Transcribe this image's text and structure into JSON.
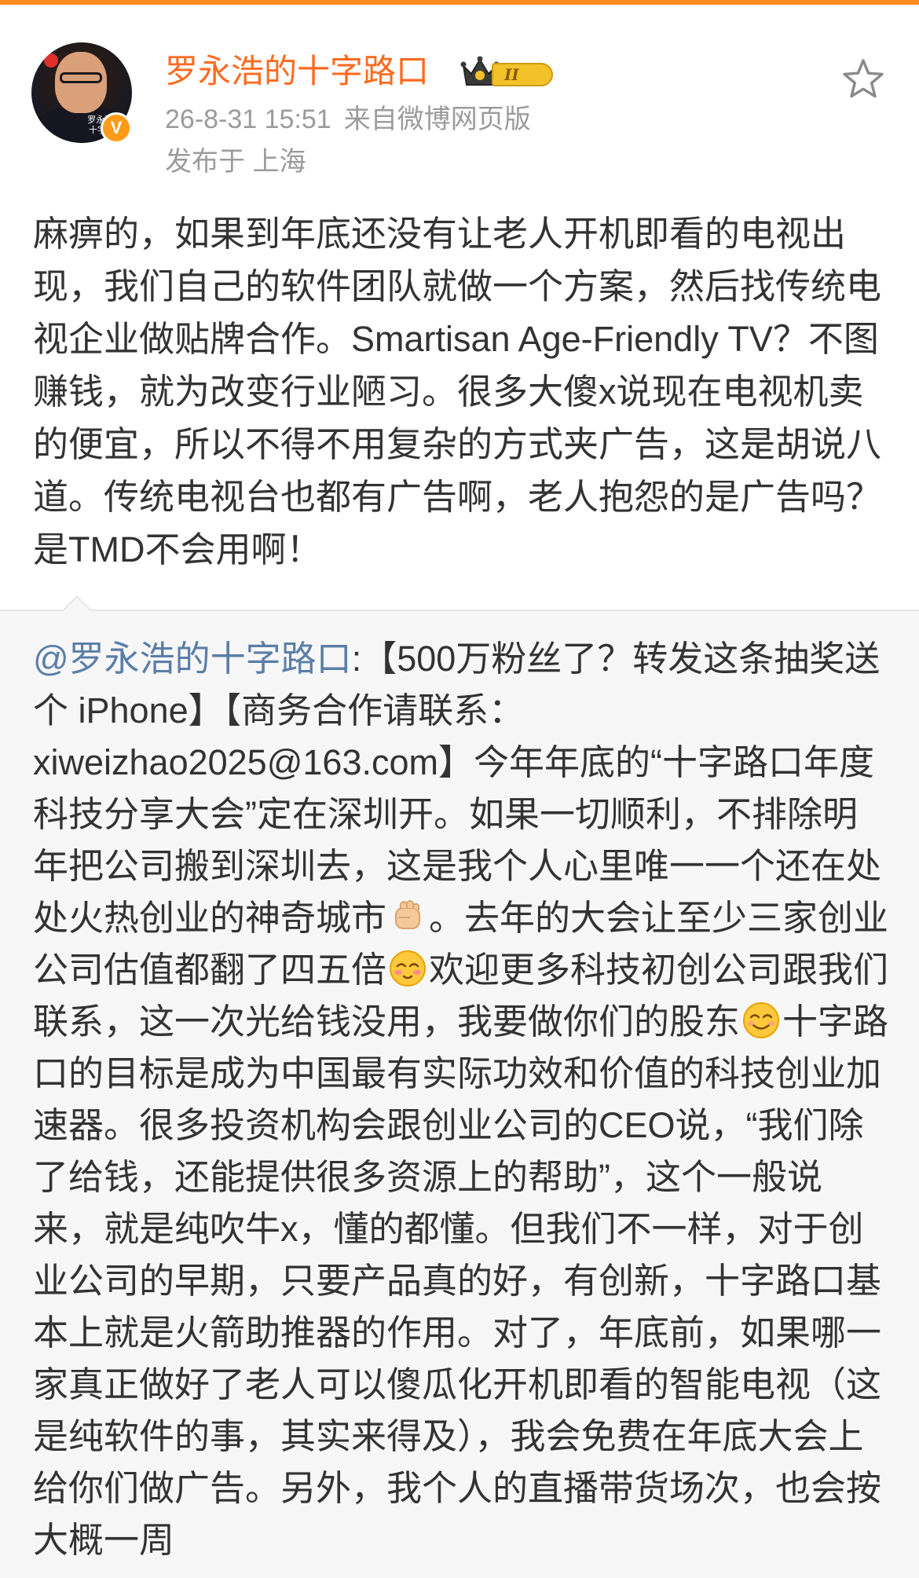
{
  "post": {
    "author": {
      "name": "罗永浩的十字路口",
      "avatar_caption": "罗永浩 的十字路口",
      "verified_mark": "V",
      "vip_level": "II"
    },
    "meta": {
      "time": "26-8-31 15:51",
      "source": "来自微博网页版",
      "location": "发布于 上海"
    },
    "text": "麻痹的，如果到年底还没有让老人开机即看的电视出现，我们自己的软件团队就做一个方案，然后找传统电视企业做贴牌合作。Smartisan Age-Friendly TV？不图赚钱，就为改变行业陋习。很多大傻x说现在电视机卖的便宜，所以不得不用复杂的方式夹广告，这是胡说八道。传统电视台也都有广告啊，老人抱怨的是广告吗？是TMD不会用啊！",
    "actions": {
      "favorite_icon": "star-outline-icon"
    }
  },
  "repost": {
    "mention": "@罗永浩的十字路口",
    "segments": {
      "s1": ":【500万粉丝了？转发这条抽奖送个 iPhone】【商务合作请联系：xiweizhao2025@163.com】今年年底的“十字路口年度科技分享大会”定在深圳开。如果一切顺利，不排除明年把公司搬到深圳去，这是我个人心里唯一一个还在处处火热创业的神奇城市",
      "s2": "。去年的大会让至少三家创业公司估值都翻了四五倍",
      "s3": "欢迎更多科技初创公司跟我们联系，这一次光给钱没用，我要做你们的股东",
      "s4": "十字路口的目标是成为中国最有实际功效和价值的科技创业加速器。很多投资机构会跟创业公司的CEO说，“我们除了给钱，还能提供很多资源上的帮助”，这个一般说来，就是纯吹牛x，懂的都懂。但我们不一样，对于创业公司的早期，只要产品真的好，有创新，十字路口基本上就是火箭助推器的作用。对了，年底前，如果哪一家真正做好了老人可以傻瓜化开机即看的智能电视（这是纯软件的事，其实来得及），我会免费在年底大会上给你们做广告。另外，我个人的直播带货场次，也会按大概一周"
    },
    "emojis": [
      "fist-emoji-icon",
      "blushing-emoji-icon",
      "smiling-emoji-icon"
    ]
  },
  "colors": {
    "accent": "#ff6a1f",
    "link": "#5b7ea8",
    "meta": "#9b9b9b",
    "text": "#333333",
    "top_bar": "#ff8a1e"
  }
}
